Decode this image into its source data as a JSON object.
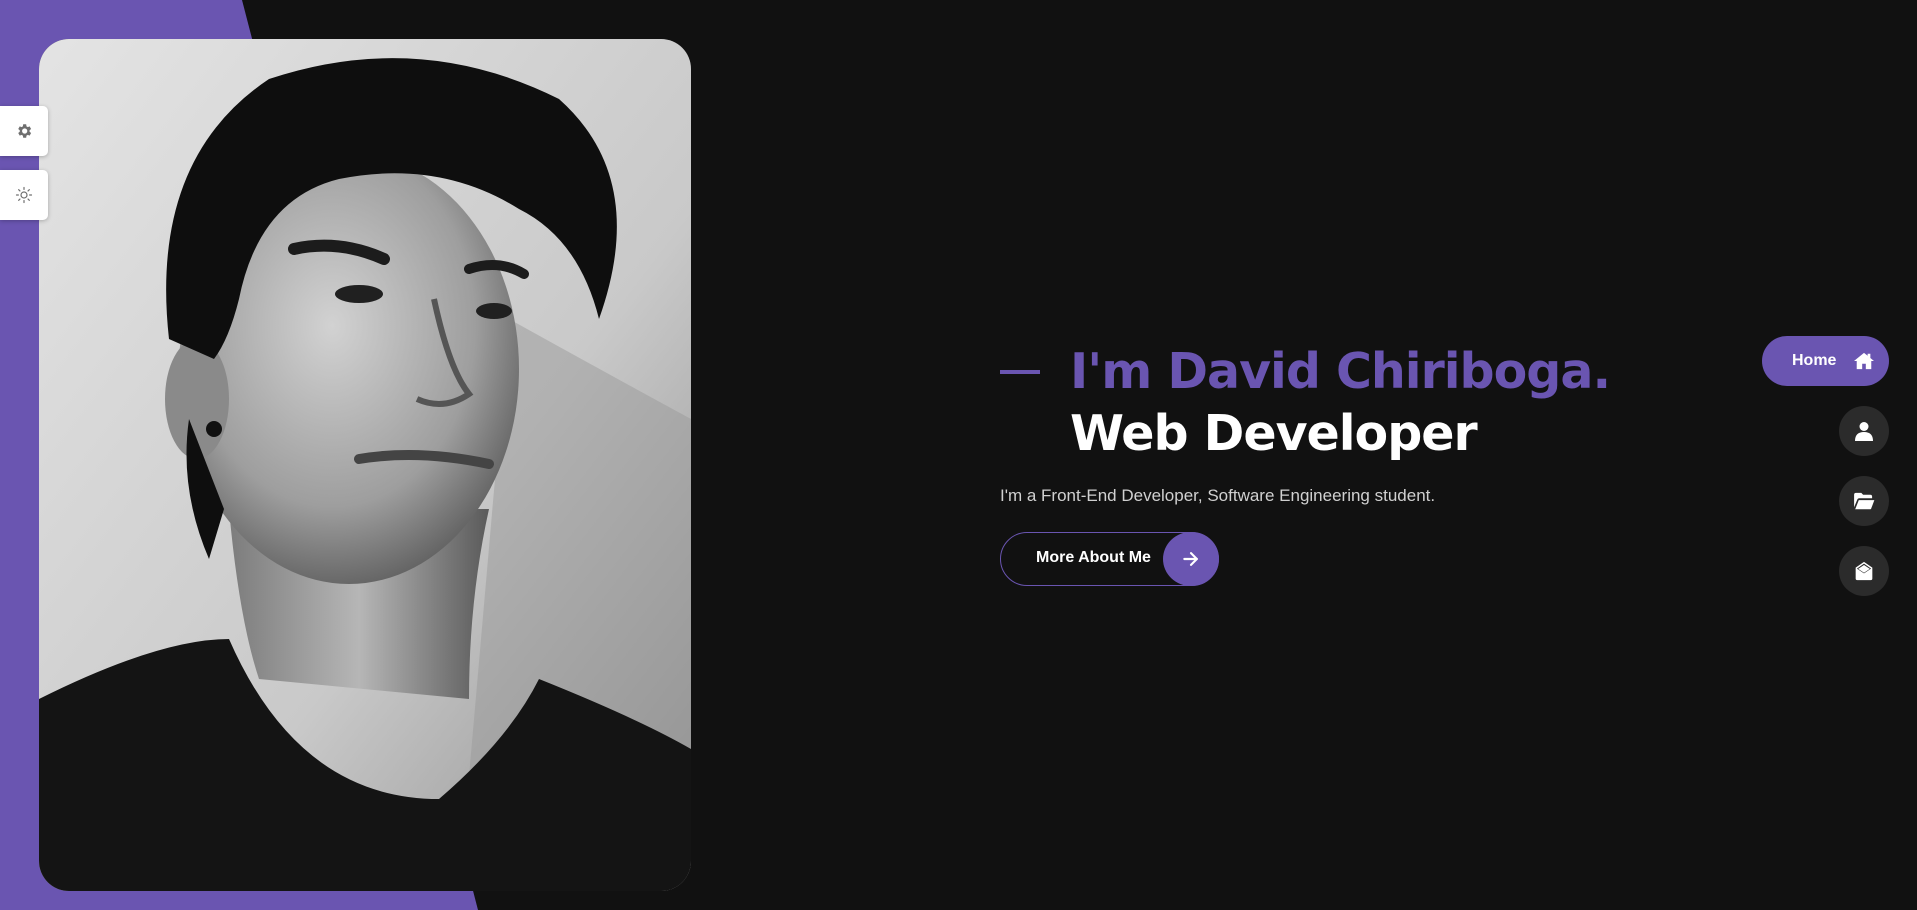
{
  "colors": {
    "accent": "#6a55b1",
    "background": "#111111",
    "nav_button_bg": "#2b2b2b",
    "text_primary": "#ffffff",
    "text_muted": "#d0d0d0"
  },
  "profile_photo": {
    "icon": "portrait-photo",
    "style": "black-and-white"
  },
  "side_widgets": [
    {
      "icon": "gear-icon"
    },
    {
      "icon": "sun-icon"
    }
  ],
  "hero": {
    "name_line": "I'm David Chiriboga.",
    "role_line": "Web Developer",
    "description": "I'm a Front-End Developer, Software Engineering student.",
    "cta_label": "More About Me",
    "cta_icon": "arrow-right-icon"
  },
  "nav": {
    "items": [
      {
        "label": "Home",
        "icon": "home-icon",
        "active": true
      },
      {
        "label": "",
        "icon": "user-icon",
        "active": false
      },
      {
        "label": "",
        "icon": "folder-open-icon",
        "active": false
      },
      {
        "label": "",
        "icon": "envelope-open-icon",
        "active": false
      }
    ]
  }
}
